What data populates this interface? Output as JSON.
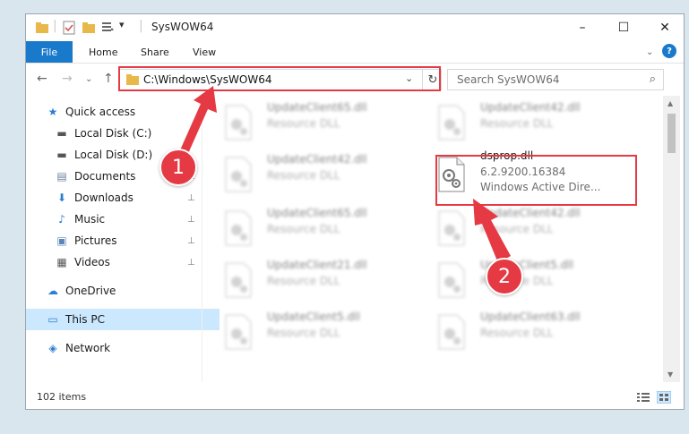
{
  "window": {
    "title": "SysWOW64",
    "minimize": "–",
    "maximize": "☐",
    "close": "✕"
  },
  "ribbon": {
    "file": "File",
    "tabs": [
      "Home",
      "Share",
      "View"
    ],
    "help": "?",
    "collapse": "⌄"
  },
  "nav": {
    "back": "←",
    "forward": "→",
    "recent": "⌄",
    "up": "↑"
  },
  "address": {
    "path": "C:\\Windows\\SysWOW64",
    "dropdown": "⌄",
    "refresh": "↻"
  },
  "search": {
    "placeholder": "Search SysWOW64",
    "icon": "⌕"
  },
  "sidebar": {
    "items": [
      {
        "label": "Quick access",
        "icon": "star-icon",
        "glyph": "★",
        "color": "#2d7dd2",
        "pinned": false
      },
      {
        "label": "Local Disk (C:)",
        "icon": "drive-icon",
        "glyph": "▬",
        "color": "#555555",
        "pinned": false
      },
      {
        "label": "Local Disk (D:)",
        "icon": "drive-icon",
        "glyph": "▬",
        "color": "#555555",
        "pinned": false
      },
      {
        "label": "Documents",
        "icon": "documents-icon",
        "glyph": "▤",
        "color": "#6b7f99",
        "pinned": true
      },
      {
        "label": "Downloads",
        "icon": "download-icon",
        "glyph": "⬇",
        "color": "#2d7dd2",
        "pinned": true
      },
      {
        "label": "Music",
        "icon": "music-icon",
        "glyph": "♪",
        "color": "#2d7dd2",
        "pinned": true
      },
      {
        "label": "Pictures",
        "icon": "pictures-icon",
        "glyph": "▣",
        "color": "#5a86b8",
        "pinned": true
      },
      {
        "label": "Videos",
        "icon": "videos-icon",
        "glyph": "▦",
        "color": "#555555",
        "pinned": true
      },
      {
        "label": "OneDrive",
        "icon": "cloud-icon",
        "glyph": "☁",
        "color": "#2d7dd2",
        "pinned": false
      },
      {
        "label": "This PC",
        "icon": "computer-icon",
        "glyph": "▭",
        "color": "#2d7dd2",
        "pinned": false,
        "selected": true
      },
      {
        "label": "Network",
        "icon": "network-icon",
        "glyph": "◈",
        "color": "#2d7dd2",
        "pinned": false
      }
    ],
    "pin_glyph": "📌"
  },
  "files": [
    {
      "name": "UpdateClient65.dll",
      "type": "Resource DLL",
      "blurred": true
    },
    {
      "name": "UpdateClient42.dll",
      "type": "Resource DLL",
      "blurred": true
    },
    {
      "name": "UpdateClient42.dll",
      "type": "Resource DLL",
      "blurred": true
    },
    {
      "name": "dsprop.dll",
      "type": "6.2.9200.16384",
      "desc": "Windows Active Dire...",
      "blurred": false
    },
    {
      "name": "UpdateClient65.dll",
      "type": "Resource DLL",
      "blurred": true
    },
    {
      "name": "UpdateClient42.dll",
      "type": "Resource DLL",
      "blurred": true
    },
    {
      "name": "UpdateClient21.dll",
      "type": "Resource DLL",
      "blurred": true
    },
    {
      "name": "UpdateClient5.dll",
      "type": "Resource DLL",
      "blurred": true
    },
    {
      "name": "UpdateClient5.dll",
      "type": "Resource DLL",
      "blurred": true
    },
    {
      "name": "UpdateClient63.dll",
      "type": "Resource DLL",
      "blurred": true
    }
  ],
  "status": {
    "count": "102 items"
  },
  "callouts": [
    "1",
    "2"
  ],
  "colors": {
    "accent": "#1979ca",
    "callout": "#e53a44",
    "selection": "#cce8ff"
  }
}
